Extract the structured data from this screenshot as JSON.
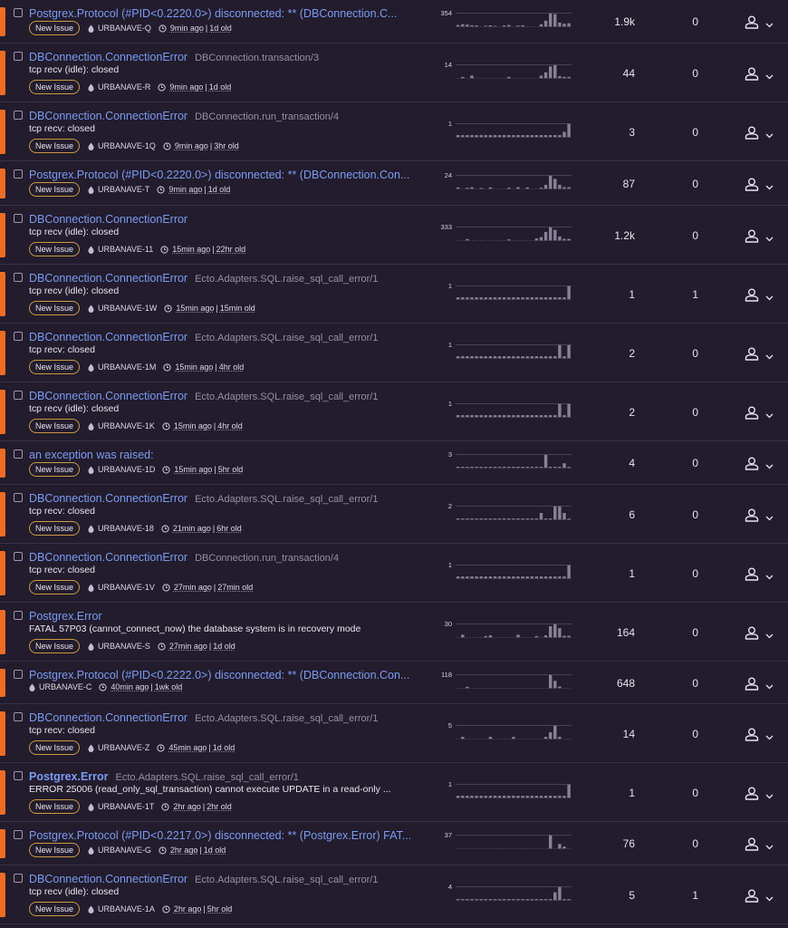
{
  "colors": {
    "accent": "#f06c25",
    "link": "#7b9bf2",
    "bar": "#8a8197",
    "badge_border": "#c99a43"
  },
  "icons": {
    "checkbox": "checkbox-icon",
    "project": "project-icon",
    "clock": "clock-icon",
    "assignee": "user-icon",
    "chevron": "chevron-down-icon"
  },
  "issues": [
    {
      "title": "Postgrex.Protocol (#PID<0.2220.0>) disconnected: ** (DBConnection.C...",
      "bold": false,
      "culprit": "",
      "message": "",
      "badge": "New Issue",
      "project": "URBANAVE-Q",
      "last_seen": "9min ago",
      "first_seen": "1d old",
      "events": "1.9k",
      "users": "0",
      "graph_max": "354",
      "bars": [
        12,
        18,
        15,
        10,
        8,
        0,
        6,
        9,
        5,
        0,
        8,
        12,
        0,
        7,
        10,
        0,
        0,
        0,
        18,
        45,
        100,
        95,
        30,
        22,
        25
      ]
    },
    {
      "title": "DBConnection.ConnectionError",
      "bold": false,
      "culprit": "DBConnection.transaction/3",
      "message": "tcp recv (idle): closed",
      "badge": "New Issue",
      "project": "URBANAVE-R",
      "last_seen": "9min ago",
      "first_seen": "1d old",
      "events": "44",
      "users": "0",
      "graph_max": "14",
      "bars": [
        0,
        10,
        0,
        20,
        0,
        0,
        0,
        0,
        0,
        0,
        0,
        10,
        0,
        0,
        0,
        0,
        0,
        0,
        20,
        45,
        90,
        100,
        15,
        10,
        10
      ]
    },
    {
      "title": "DBConnection.ConnectionError",
      "bold": false,
      "culprit": "DBConnection.run_transaction/4",
      "message": "tcp recv: closed",
      "badge": "New Issue",
      "project": "URBANAVE-1Q",
      "last_seen": "9min ago",
      "first_seen": "3hr old",
      "events": "3",
      "users": "0",
      "graph_max": "1",
      "bars": [
        15,
        15,
        15,
        15,
        15,
        15,
        15,
        15,
        15,
        15,
        15,
        15,
        15,
        15,
        15,
        15,
        15,
        15,
        15,
        15,
        15,
        15,
        15,
        40,
        100
      ]
    },
    {
      "title": "Postgrex.Protocol (#PID<0.2220.0>) disconnected: ** (DBConnection.Con...",
      "bold": false,
      "culprit": "",
      "message": "",
      "badge": "New Issue",
      "project": "URBANAVE-T",
      "last_seen": "9min ago",
      "first_seen": "1d old",
      "events": "87",
      "users": "0",
      "graph_max": "24",
      "bars": [
        10,
        0,
        8,
        12,
        0,
        6,
        0,
        10,
        0,
        0,
        0,
        8,
        0,
        12,
        0,
        10,
        0,
        0,
        8,
        30,
        100,
        75,
        30,
        12,
        12
      ]
    },
    {
      "title": "DBConnection.ConnectionError",
      "bold": false,
      "culprit": "",
      "message": "tcp recv (idle): closed",
      "badge": "New Issue",
      "project": "URBANAVE-11",
      "last_seen": "15min ago",
      "first_seen": "22hr old",
      "events": "1.2k",
      "users": "0",
      "graph_max": "333",
      "bars": [
        0,
        0,
        10,
        0,
        0,
        0,
        0,
        0,
        0,
        0,
        0,
        8,
        0,
        0,
        0,
        0,
        0,
        15,
        25,
        65,
        100,
        80,
        30,
        12,
        12
      ]
    },
    {
      "title": "DBConnection.ConnectionError",
      "bold": false,
      "culprit": "Ecto.Adapters.SQL.raise_sql_call_error/1",
      "message": "tcp recv (idle): closed",
      "badge": "New Issue",
      "project": "URBANAVE-1W",
      "last_seen": "15min ago",
      "first_seen": "15min old",
      "events": "1",
      "users": "1",
      "graph_max": "1",
      "bars": [
        15,
        15,
        15,
        15,
        15,
        15,
        15,
        15,
        15,
        15,
        15,
        15,
        15,
        15,
        15,
        15,
        15,
        15,
        15,
        15,
        15,
        15,
        15,
        15,
        100
      ]
    },
    {
      "title": "DBConnection.ConnectionError",
      "bold": false,
      "culprit": "Ecto.Adapters.SQL.raise_sql_call_error/1",
      "message": "tcp recv: closed",
      "badge": "New Issue",
      "project": "URBANAVE-1M",
      "last_seen": "15min ago",
      "first_seen": "4hr old",
      "events": "2",
      "users": "0",
      "graph_max": "1",
      "bars": [
        15,
        15,
        15,
        15,
        15,
        15,
        15,
        15,
        15,
        15,
        15,
        15,
        15,
        15,
        15,
        15,
        15,
        15,
        15,
        15,
        15,
        15,
        100,
        15,
        100
      ]
    },
    {
      "title": "DBConnection.ConnectionError",
      "bold": false,
      "culprit": "Ecto.Adapters.SQL.raise_sql_call_error/1",
      "message": "tcp recv (idle): closed",
      "badge": "New Issue",
      "project": "URBANAVE-1K",
      "last_seen": "15min ago",
      "first_seen": "4hr old",
      "events": "2",
      "users": "0",
      "graph_max": "1",
      "bars": [
        15,
        15,
        15,
        15,
        15,
        15,
        15,
        15,
        15,
        15,
        15,
        15,
        15,
        15,
        15,
        15,
        15,
        15,
        15,
        15,
        15,
        15,
        100,
        15,
        100
      ]
    },
    {
      "title": "an exception was raised:",
      "bold": false,
      "culprit": "",
      "message": "",
      "badge": "New Issue",
      "project": "URBANAVE-1D",
      "last_seen": "15min ago",
      "first_seen": "5hr old",
      "events": "4",
      "users": "0",
      "graph_max": "3",
      "bars": [
        8,
        8,
        8,
        8,
        8,
        8,
        8,
        8,
        8,
        8,
        8,
        8,
        8,
        8,
        8,
        8,
        8,
        8,
        8,
        100,
        8,
        8,
        8,
        35,
        8
      ]
    },
    {
      "title": "DBConnection.ConnectionError",
      "bold": false,
      "culprit": "Ecto.Adapters.SQL.raise_sql_call_error/1",
      "message": "tcp recv: closed",
      "badge": "New Issue",
      "project": "URBANAVE-18",
      "last_seen": "21min ago",
      "first_seen": "6hr old",
      "events": "6",
      "users": "0",
      "graph_max": "2",
      "bars": [
        8,
        8,
        8,
        8,
        8,
        8,
        8,
        8,
        8,
        8,
        8,
        8,
        8,
        8,
        8,
        8,
        8,
        8,
        50,
        8,
        8,
        100,
        100,
        50,
        8
      ]
    },
    {
      "title": "DBConnection.ConnectionError",
      "bold": false,
      "culprit": "DBConnection.run_transaction/4",
      "message": "tcp recv: closed",
      "badge": "New Issue",
      "project": "URBANAVE-1V",
      "last_seen": "27min ago",
      "first_seen": "27min old",
      "events": "1",
      "users": "0",
      "graph_max": "1",
      "bars": [
        15,
        15,
        15,
        15,
        15,
        15,
        15,
        15,
        15,
        15,
        15,
        15,
        15,
        15,
        15,
        15,
        15,
        15,
        15,
        15,
        15,
        15,
        15,
        15,
        100
      ]
    },
    {
      "title": "Postgrex.Error",
      "bold": false,
      "culprit": "",
      "message": "FATAL 57P03 (cannot_connect_now) the database system is in recovery mode",
      "badge": "New Issue",
      "project": "URBANAVE-S",
      "last_seen": "27min ago",
      "first_seen": "1d old",
      "events": "164",
      "users": "0",
      "graph_max": "30",
      "bars": [
        0,
        20,
        0,
        0,
        0,
        0,
        10,
        15,
        0,
        0,
        0,
        0,
        0,
        20,
        0,
        0,
        0,
        10,
        0,
        15,
        85,
        100,
        70,
        12,
        12
      ]
    },
    {
      "title": "Postgrex.Protocol (#PID<0.2222.0>) disconnected: ** (DBConnection.Con...",
      "bold": false,
      "culprit": "",
      "message": "",
      "badge": "",
      "project": "URBANAVE-C",
      "last_seen": "40min ago",
      "first_seen": "1wk old",
      "events": "648",
      "users": "0",
      "graph_max": "118",
      "bars": [
        0,
        0,
        10,
        0,
        0,
        0,
        0,
        0,
        0,
        0,
        0,
        0,
        0,
        0,
        0,
        0,
        0,
        0,
        0,
        0,
        100,
        55,
        12,
        0,
        0
      ]
    },
    {
      "title": "DBConnection.ConnectionError",
      "bold": false,
      "culprit": "Ecto.Adapters.SQL.raise_sql_call_error/1",
      "message": "tcp recv: closed",
      "badge": "New Issue",
      "project": "URBANAVE-Z",
      "last_seen": "45min ago",
      "first_seen": "1d old",
      "events": "14",
      "users": "0",
      "graph_max": "5",
      "bars": [
        0,
        15,
        0,
        0,
        0,
        0,
        0,
        15,
        0,
        0,
        0,
        0,
        15,
        0,
        0,
        0,
        0,
        0,
        0,
        15,
        50,
        100,
        15,
        0,
        0
      ]
    },
    {
      "title": "Postgrex.Error",
      "bold": true,
      "culprit": "Ecto.Adapters.SQL.raise_sql_call_error/1",
      "message": "ERROR 25006 (read_only_sql_transaction) cannot execute UPDATE in a read-only ...",
      "badge": "New Issue",
      "project": "URBANAVE-1T",
      "last_seen": "2hr ago",
      "first_seen": "2hr old",
      "events": "1",
      "users": "0",
      "graph_max": "1",
      "bars": [
        15,
        15,
        15,
        15,
        15,
        15,
        15,
        15,
        15,
        15,
        15,
        15,
        15,
        15,
        15,
        15,
        15,
        15,
        15,
        15,
        15,
        15,
        15,
        15,
        100
      ]
    },
    {
      "title": "Postgrex.Protocol (#PID<0.2217.0>) disconnected: ** (Postgrex.Error) FAT...",
      "bold": false,
      "culprit": "",
      "message": "",
      "badge": "New Issue",
      "project": "URBANAVE-G",
      "last_seen": "2hr ago",
      "first_seen": "1d old",
      "events": "76",
      "users": "0",
      "graph_max": "37",
      "bars": [
        0,
        0,
        0,
        0,
        0,
        0,
        0,
        0,
        0,
        0,
        0,
        0,
        0,
        0,
        0,
        0,
        0,
        0,
        0,
        0,
        100,
        0,
        35,
        15,
        0
      ]
    },
    {
      "title": "DBConnection.ConnectionError",
      "bold": false,
      "culprit": "Ecto.Adapters.SQL.raise_sql_call_error/1",
      "message": "tcp recv (idle): closed",
      "badge": "New Issue",
      "project": "URBANAVE-1A",
      "last_seen": "2hr ago",
      "first_seen": "5hr old",
      "events": "5",
      "users": "1",
      "graph_max": "4",
      "bars": [
        8,
        8,
        8,
        8,
        8,
        8,
        8,
        8,
        8,
        8,
        8,
        8,
        8,
        8,
        8,
        8,
        8,
        8,
        8,
        8,
        8,
        60,
        100,
        8,
        8
      ]
    }
  ]
}
